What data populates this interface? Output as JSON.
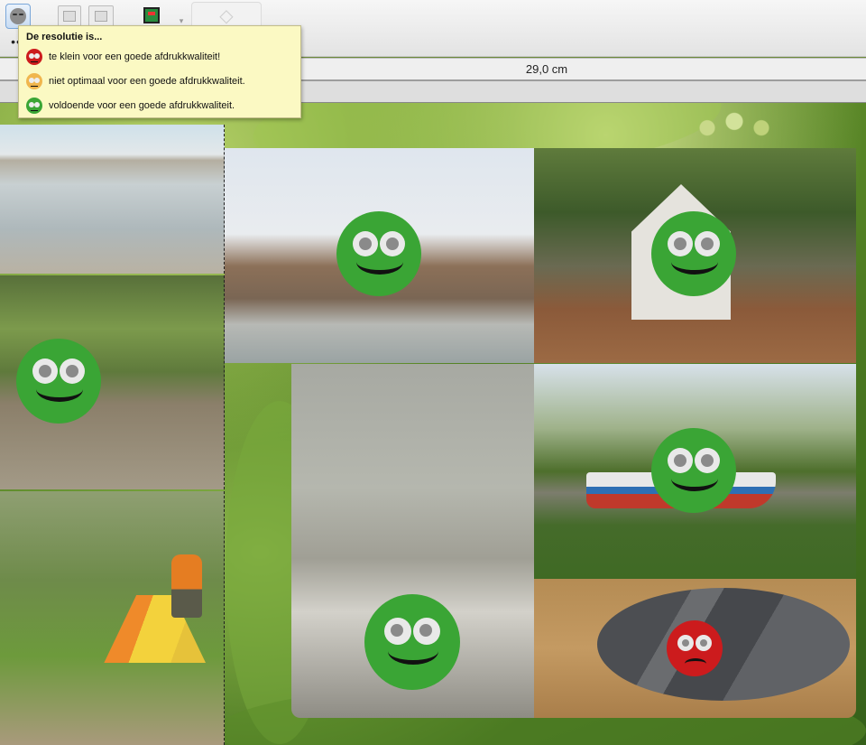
{
  "toolbar": {
    "resolution_button": "resolution-face",
    "image_buttons": [
      "image-icon",
      "image-layers-icon"
    ],
    "tool_button": "photo-tool-icon",
    "gem_button": "diamond-icon",
    "more": "••"
  },
  "ruler": {
    "label": "29,0 cm"
  },
  "tooltip": {
    "title": "De resolutie is...",
    "items": [
      {
        "status": "red",
        "text": "te klein voor een goede afdrukkwaliteit!"
      },
      {
        "status": "orange",
        "text": "niet optimaal voor een goede afdrukkwaliteit."
      },
      {
        "status": "green",
        "text": "voldoende voor een goede afdrukkwaliteit."
      }
    ]
  },
  "photos": [
    {
      "name": "beach",
      "resolution": "none"
    },
    {
      "name": "mangrove-cleanup",
      "resolution": "green"
    },
    {
      "name": "camp-tent",
      "resolution": "none"
    },
    {
      "name": "dead-trees",
      "resolution": "green"
    },
    {
      "name": "grave",
      "resolution": "green"
    },
    {
      "name": "crab",
      "resolution": "green"
    },
    {
      "name": "palm-boat",
      "resolution": "green"
    },
    {
      "name": "leatherback-turtle",
      "resolution": "red"
    }
  ],
  "colors": {
    "good": "#3aa535",
    "medium": "#f0b64e",
    "bad": "#cc1b1d",
    "tooltip_bg": "#fbf9c3"
  }
}
